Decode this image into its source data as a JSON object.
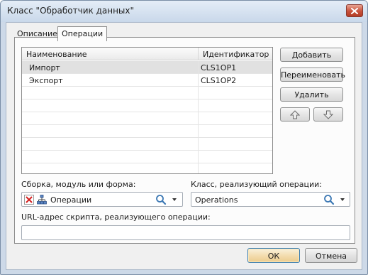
{
  "window": {
    "title": "Класс \"Обработчик данных\""
  },
  "tabs": [
    {
      "label": "Описание",
      "active": false
    },
    {
      "label": "Операции",
      "active": true
    }
  ],
  "operations_list": {
    "columns": [
      "Наименование",
      "Идентификатор"
    ],
    "rows": [
      {
        "name": "Импорт",
        "id": "CLS1OP1",
        "selected": true
      },
      {
        "name": "Экспорт",
        "id": "CLS1OP2",
        "selected": false
      }
    ]
  },
  "buttons": {
    "add": "Добавить",
    "rename": "Переименовать",
    "delete": "Удалить",
    "move_up_icon": "arrow-up-icon",
    "move_down_icon": "arrow-down-icon"
  },
  "assembly": {
    "label": "Сборка, модуль или форма:",
    "value": "Операции",
    "clear_icon": "red-x-icon",
    "type_icon": "hierarchy-icon"
  },
  "class_impl": {
    "label": "Класс, реализующий операции:",
    "value": "Operations"
  },
  "url": {
    "label": "URL-адрес скрипта, реализующего операции:",
    "value": ""
  },
  "footer": {
    "ok": "ОК",
    "cancel": "Отмена"
  },
  "colors": {
    "accent": "#3c7fb1",
    "selected_row": "#e1e1e1",
    "clear_red": "#d42020"
  }
}
